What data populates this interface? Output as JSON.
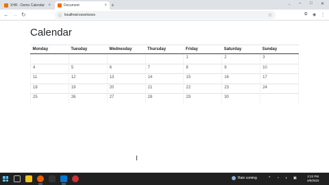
{
  "browser": {
    "tabs": [
      {
        "title": "XHR - Demo Calendar",
        "active": false
      },
      {
        "title": "Document",
        "active": true
      }
    ],
    "url": "localhost:xxxx/xxxxx",
    "newtab_symbol": "+",
    "close_symbol": "×"
  },
  "page": {
    "title": "Calendar",
    "days": [
      "Monday",
      "Tuesday",
      "Wednesday",
      "Thursday",
      "Friday",
      "Saturday",
      "Sunday"
    ],
    "weeks": [
      [
        "",
        "",
        "",
        "",
        "1",
        "2",
        "3"
      ],
      [
        "4",
        "5",
        "6",
        "7",
        "8",
        "9",
        "10"
      ],
      [
        "11",
        "12",
        "13",
        "14",
        "15",
        "16",
        "17"
      ],
      [
        "18",
        "19",
        "20",
        "21",
        "22",
        "23",
        "24"
      ],
      [
        "25",
        "26",
        "27",
        "28",
        "29",
        "30",
        ""
      ]
    ]
  },
  "taskbar": {
    "weather_text": "Rain coming",
    "time": "2:22 PM",
    "date": "4/8/2022"
  },
  "colors": {
    "tabstrip": "#dee1e6",
    "taskbar": "#202020",
    "accent": "#e8710a"
  }
}
